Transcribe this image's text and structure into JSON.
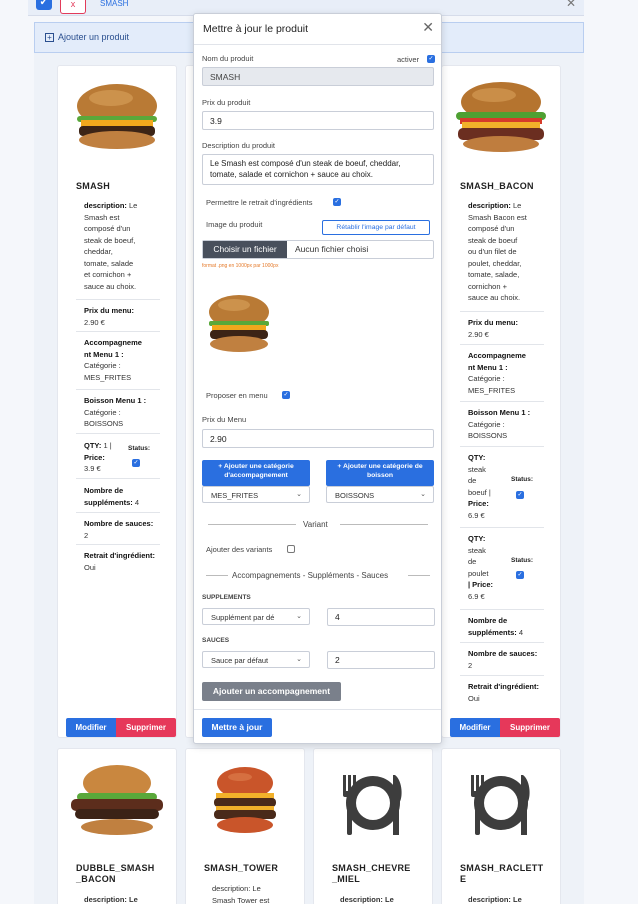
{
  "top_bar": {
    "item_name": "SMASH",
    "x_label": "x"
  },
  "add_product_label": "Ajouter un produit",
  "colors": {
    "primary": "#2a6fe0",
    "danger": "#e6385a",
    "hint": "#e57a2a"
  },
  "card_actions": {
    "edit": "Modifier",
    "delete": "Supprimer"
  },
  "left_card": {
    "name": "SMASH",
    "description_label": "description:",
    "description_lines": [
      "Le",
      "Smash est",
      "composé d'un",
      "steak de boeuf,",
      "cheddar,",
      "tomate, salade",
      "et cornichon +",
      "sauce au choix."
    ],
    "menu_price_label": "Prix du menu:",
    "menu_price": "2.90 €",
    "side_label_lines": [
      "Accompagneme",
      "nt Menu 1 :"
    ],
    "side_category": [
      "Catégorie :",
      "MES_FRITES"
    ],
    "drink_label": "Boisson Menu 1 :",
    "drink_category": [
      "Catégorie :",
      "BOISSONS"
    ],
    "qty_label": "QTY:",
    "qty_value": "1",
    "price_label": "Price:",
    "price_value": "3.9 €",
    "status_label": "Status:",
    "supplements_label": "Nombre de suppléments:",
    "supplements_value": "4",
    "sauces_label": "Nombre de sauces:",
    "sauces_value": "2",
    "retrait_label": "Retrait d'ingrédient:",
    "retrait_value": "Oui"
  },
  "right_card": {
    "name": "SMASH_BACON",
    "description_label": "description:",
    "description_lines": [
      "Le",
      "Smash Bacon est",
      "composé d'un",
      "steak de boeuf",
      "ou d'un filet de",
      "poulet, cheddar,",
      "tomate, salade,",
      "cornichon +",
      "sauce au choix."
    ],
    "menu_price_label": "Prix du menu:",
    "menu_price": "2.90 €",
    "side_label_lines": [
      "Accompagneme",
      "nt Menu 1 :"
    ],
    "side_category": [
      "Catégorie :",
      "MES_FRITES"
    ],
    "drink_label": "Boisson Menu 1 :",
    "drink_category": [
      "Catégorie :",
      "BOISSONS"
    ],
    "qty1_lines": [
      "QTY:",
      "steak",
      "de",
      "boeuf |",
      "Price:",
      "6.9 €"
    ],
    "qty2_lines": [
      "QTY:",
      "steak",
      "de",
      "poulet",
      "| Price:",
      "6.9 €"
    ],
    "status_label": "Status:",
    "supplements_label": "Nombre de suppléments:",
    "supplements_value": "4",
    "sauces_label": "Nombre de sauces:",
    "sauces_value": "2",
    "retrait_label": "Retrait d'ingrédient:",
    "retrait_value": "Oui"
  },
  "bottom_cards": [
    {
      "name_lines": [
        "DUBBLE_SMASH",
        "_BACON"
      ],
      "desc": "description: Le",
      "icon": "burger-image"
    },
    {
      "name_lines": [
        "SMASH_TOWER"
      ],
      "desc": "description: Le",
      "desc2": "Smash Tower est",
      "icon": "burger-image"
    },
    {
      "name_lines": [
        "SMASH_CHEVRE",
        "_MIEL"
      ],
      "desc": "description: Le",
      "icon": "cutlery-icon"
    },
    {
      "name_lines": [
        "SMASH_RACLETT",
        "E"
      ],
      "desc": "description: Le",
      "icon": "cutlery-icon"
    }
  ],
  "modal": {
    "title": "Mettre à jour le produit",
    "name_label": "Nom du produit",
    "active_label": "activer",
    "name_value": "SMASH",
    "price_label": "Prix du produit",
    "price_value": "3.9",
    "description_label": "Description du produit",
    "description_value": "Le Smash est composé d'un steak de boeuf, cheddar, tomate, salade et cornichon + sauce au choix.",
    "retrait_label": "Permettre le retrait d'ingrédients",
    "image_label": "Image du produit",
    "reset_image": "Rétablir l'image par défaut",
    "choose_file": "Choisir un fichier",
    "no_file": "Aucun fichier choisi",
    "format_hint": "format .png en 1000px par 1000px",
    "menu_label": "Proposer en menu",
    "menu_price_label": "Prix du Menu",
    "menu_price_value": "2.90",
    "add_side_category": "+ Ajouter une catégorie d'accompagnement",
    "add_drink_category": "+ Ajouter une catégorie de boisson",
    "side_select": "MES_FRITES",
    "drink_select": "BOISSONS",
    "variant_separator": "Variant",
    "add_variants_label": "Ajouter des variants",
    "sides_separator": "Accompagnements - Suppléments - Sauces",
    "supplements_label": "SUPPLEMENTS",
    "supplements_select": "Supplément par dé",
    "supplements_value": "4",
    "sauces_label": "SAUCES",
    "sauces_select": "Sauce par défaut",
    "sauces_value": "2",
    "add_side_button": "Ajouter un accompagnement",
    "save_button": "Mettre à jour"
  }
}
